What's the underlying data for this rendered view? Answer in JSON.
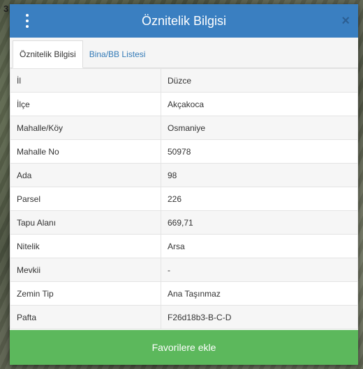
{
  "background_mark": "3",
  "dialog": {
    "title": "Öznitelik Bilgisi",
    "close_label": "×"
  },
  "tabs": [
    {
      "label": "Öznitelik Bilgisi",
      "active": true
    },
    {
      "label": "Bina/BB Listesi",
      "active": false
    }
  ],
  "rows": [
    {
      "key": "İl",
      "value": "Düzce"
    },
    {
      "key": "İlçe",
      "value": "Akçakoca"
    },
    {
      "key": "Mahalle/Köy",
      "value": "Osmaniye"
    },
    {
      "key": "Mahalle No",
      "value": "50978"
    },
    {
      "key": "Ada",
      "value": "98"
    },
    {
      "key": "Parsel",
      "value": "226"
    },
    {
      "key": "Tapu Alanı",
      "value": "669,71"
    },
    {
      "key": "Nitelik",
      "value": "Arsa"
    },
    {
      "key": "Mevkii",
      "value": "-"
    },
    {
      "key": "Zemin Tip",
      "value": "Ana Taşınmaz"
    },
    {
      "key": "Pafta",
      "value": "F26d18b3-B-C-D"
    }
  ],
  "favorite_button": "Favorilere ekle",
  "colors": {
    "header": "#3a7fc1",
    "button": "#5cb85c"
  }
}
